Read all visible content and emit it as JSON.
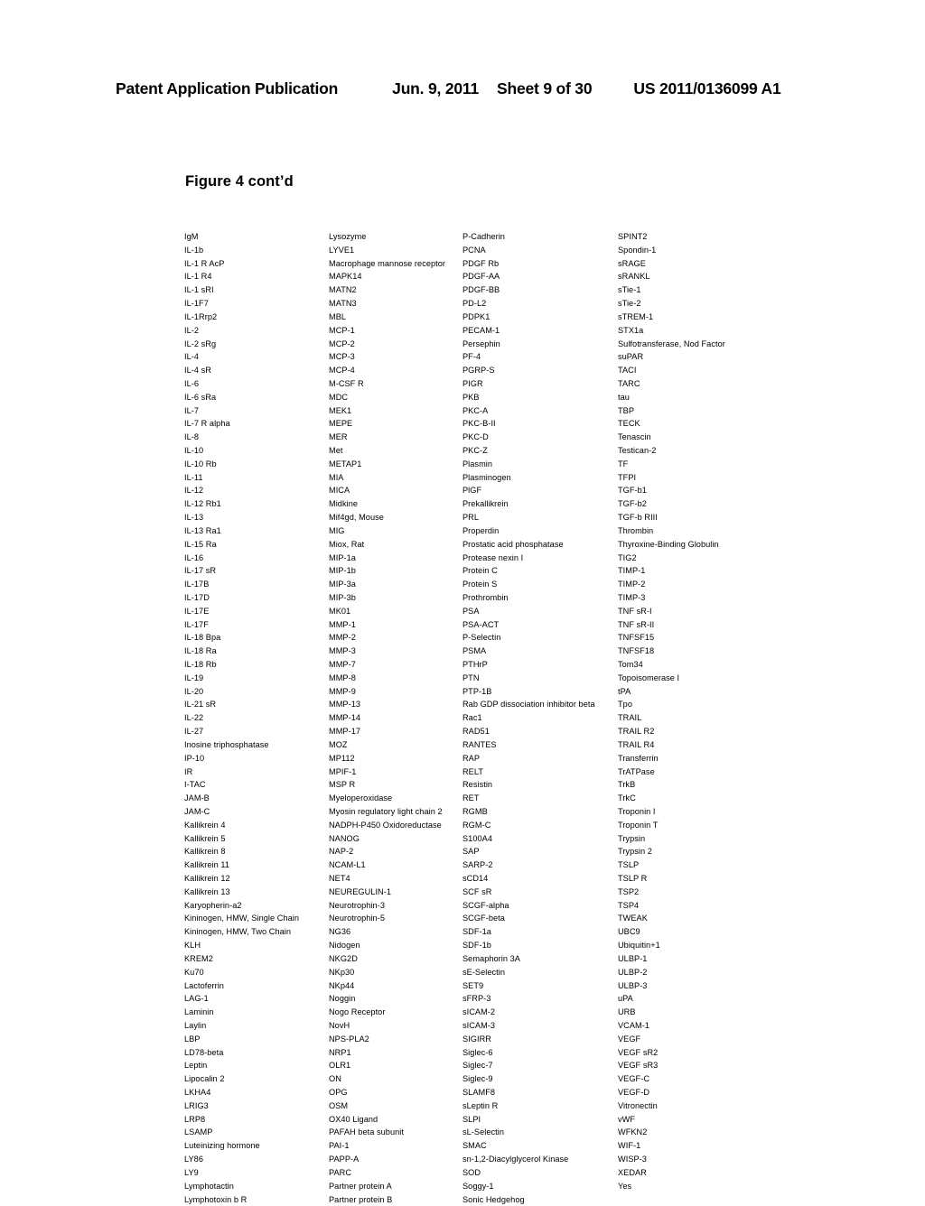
{
  "header": {
    "publication": "Patent Application Publication",
    "date": "Jun. 9, 2011",
    "sheet": "Sheet 9 of 30",
    "document_number": "US 2011/0136099 A1"
  },
  "figure": {
    "title": "Figure 4 cont’d"
  },
  "columns": [
    {
      "id": "column-1",
      "entries": [
        "IgM",
        "IL-1b",
        "IL-1 R AcP",
        "IL-1 R4",
        "IL-1 sRI",
        "IL-1F7",
        "IL-1Rrp2",
        "IL-2",
        "IL-2 sRg",
        "IL-4",
        "IL-4 sR",
        "IL-6",
        "IL-6 sRa",
        "IL-7",
        "IL-7 R alpha",
        "IL-8",
        "IL-10",
        "IL-10 Rb",
        "IL-11",
        "IL-12",
        "IL-12 Rb1",
        "IL-13",
        "IL-13 Ra1",
        "IL-15 Ra",
        "IL-16",
        "IL-17 sR",
        "IL-17B",
        "IL-17D",
        "IL-17E",
        "IL-17F",
        "IL-18 Bpa",
        "IL-18 Ra",
        "IL-18 Rb",
        "IL-19",
        "IL-20",
        "IL-21 sR",
        "IL-22",
        "IL-27",
        "Inosine triphosphatase",
        "IP-10",
        "IR",
        "I-TAC",
        "JAM-B",
        "JAM-C",
        "Kallikrein 4",
        "Kallikrein 5",
        "Kallikrein 8",
        "Kallikrein 11",
        "Kallikrein 12",
        "Kallikrein 13",
        "Karyopherin-a2",
        "Kininogen, HMW, Single Chain",
        "Kininogen, HMW, Two Chain",
        "KLH",
        "KREM2",
        "Ku70",
        "Lactoferrin",
        "LAG-1",
        "Laminin",
        "Laylin",
        "LBP",
        "LD78-beta",
        "Leptin",
        "Lipocalin 2",
        "LKHA4",
        "LRIG3",
        "LRP8",
        "LSAMP",
        "Luteinizing hormone",
        "LY86",
        "LY9",
        "Lymphotactin",
        "Lymphotoxin b R"
      ]
    },
    {
      "id": "column-2",
      "entries": [
        "Lysozyme",
        "LYVE1",
        "Macrophage mannose receptor",
        "MAPK14",
        "MATN2",
        "MATN3",
        "MBL",
        "MCP-1",
        "MCP-2",
        "MCP-3",
        "MCP-4",
        "M-CSF R",
        "MDC",
        "MEK1",
        "MEPE",
        "MER",
        "Met",
        "METAP1",
        "MIA",
        "MICA",
        "Midkine",
        "Mif4gd, Mouse",
        "MIG",
        "Miox, Rat",
        "MIP-1a",
        "MIP-1b",
        "MIP-3a",
        "MIP-3b",
        "MK01",
        "MMP-1",
        "MMP-2",
        "MMP-3",
        "MMP-7",
        "MMP-8",
        "MMP-9",
        "MMP-13",
        "MMP-14",
        "MMP-17",
        "MOZ",
        "MP112",
        "MPIF-1",
        "MSP R",
        "Myeloperoxidase",
        "Myosin regulatory light chain 2",
        "NADPH-P450 Oxidoreductase",
        "NANOG",
        "NAP-2",
        "NCAM-L1",
        "NET4",
        "NEUREGULIN-1",
        "Neurotrophin-3",
        "Neurotrophin-5",
        "NG36",
        "Nidogen",
        "NKG2D",
        "NKp30",
        "NKp44",
        "Noggin",
        "Nogo Receptor",
        "NovH",
        "NPS-PLA2",
        "NRP1",
        "OLR1",
        "ON",
        "OPG",
        "OSM",
        "OX40 Ligand",
        "PAFAH beta subunit",
        "PAI-1",
        "PAPP-A",
        "PARC",
        "Partner protein A",
        "Partner protein B"
      ]
    },
    {
      "id": "column-3",
      "entries": [
        "P-Cadherin",
        "PCNA",
        "PDGF Rb",
        "PDGF-AA",
        "PDGF-BB",
        "PD-L2",
        "PDPK1",
        "PECAM-1",
        "Persephin",
        "PF-4",
        "PGRP-S",
        "PIGR",
        "PKB",
        "PKC-A",
        "PKC-B-II",
        "PKC-D",
        "PKC-Z",
        "Plasmin",
        "Plasminogen",
        "PlGF",
        "Prekallikrein",
        "PRL",
        "Properdin",
        "Prostatic acid phosphatase",
        "Protease nexin I",
        "Protein C",
        "Protein S",
        "Prothrombin",
        "PSA",
        "PSA-ACT",
        "P-Selectin",
        "PSMA",
        "PTHrP",
        "PTN",
        "PTP-1B",
        "Rab GDP dissociation inhibitor beta",
        "Rac1",
        "RAD51",
        "RANTES",
        "RAP",
        "RELT",
        "Resistin",
        "RET",
        "RGMB",
        "RGM-C",
        "S100A4",
        "SAP",
        "SARP-2",
        "sCD14",
        "SCF sR",
        "SCGF-alpha",
        "SCGF-beta",
        "SDF-1a",
        "SDF-1b",
        "Semaphorin 3A",
        "sE-Selectin",
        "SET9",
        "sFRP-3",
        "sICAM-2",
        "sICAM-3",
        "SIGIRR",
        "Siglec-6",
        "Siglec-7",
        "Siglec-9",
        "SLAMF8",
        "sLeptin R",
        "SLPI",
        "sL-Selectin",
        "SMAC",
        "sn-1,2-Diacylglycerol Kinase",
        "SOD",
        "Soggy-1",
        "Sonic Hedgehog"
      ]
    },
    {
      "id": "column-4",
      "entries": [
        "SPINT2",
        "Spondin-1",
        "sRAGE",
        "sRANKL",
        "sTie-1",
        "sTie-2",
        "sTREM-1",
        "STX1a",
        "Sulfotransferase, Nod Factor",
        "suPAR",
        "TACI",
        "TARC",
        "tau",
        "TBP",
        "TECK",
        "Tenascin",
        "Testican-2",
        "TF",
        "TFPI",
        "TGF-b1",
        "TGF-b2",
        "TGF-b RIII",
        "Thrombin",
        "Thyroxine-Binding Globulin",
        "TIG2",
        "TIMP-1",
        "TIMP-2",
        "TIMP-3",
        "TNF sR-I",
        "TNF sR-II",
        "TNFSF15",
        "TNFSF18",
        "Tom34",
        "Topoisomerase I",
        "tPA",
        "Tpo",
        "TRAIL",
        "TRAIL R2",
        "TRAIL R4",
        "Transferrin",
        "TrATPase",
        "TrkB",
        "TrkC",
        "Troponin I",
        "Troponin T",
        "Trypsin",
        "Trypsin 2",
        "TSLP",
        "TSLP R",
        "TSP2",
        "TSP4",
        "TWEAK",
        "UBC9",
        "Ubiquitin+1",
        "ULBP-1",
        "ULBP-2",
        "ULBP-3",
        "uPA",
        "URB",
        "VCAM-1",
        "VEGF",
        "VEGF sR2",
        "VEGF sR3",
        "VEGF-C",
        "VEGF-D",
        "Vitronectin",
        "vWF",
        "WFKN2",
        "WIF-1",
        "WISP-3",
        "XEDAR",
        "Yes"
      ]
    }
  ]
}
